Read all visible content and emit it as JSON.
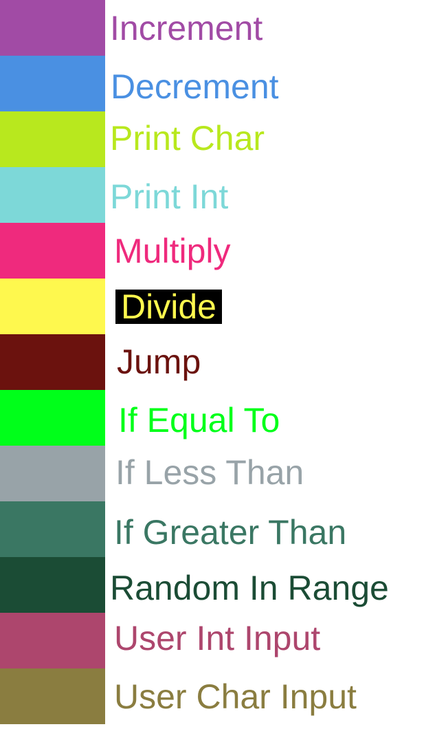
{
  "legend": {
    "items": [
      {
        "label": "Increment",
        "color": "#a14ba5"
      },
      {
        "label": "Decrement",
        "color": "#4a90e2"
      },
      {
        "label": "Print Char",
        "color": "#b8e81e"
      },
      {
        "label": "Print Int",
        "color": "#7dd8d8"
      },
      {
        "label": "Multiply",
        "color": "#ef2a7d"
      },
      {
        "label": "Divide",
        "color": "#fef84e",
        "label_background": "#000000"
      },
      {
        "label": "Jump",
        "color": "#6b120e"
      },
      {
        "label": "If Equal To",
        "color": "#00ff1a"
      },
      {
        "label": "If Less Than",
        "color": "#98a3a8"
      },
      {
        "label": "If Greater Than",
        "color": "#3a7763"
      },
      {
        "label": "Random In Range",
        "color": "#1b4c35"
      },
      {
        "label": "User Int Input",
        "color": "#ad466d"
      },
      {
        "label": "User Char Input",
        "color": "#8a7d40"
      }
    ]
  }
}
